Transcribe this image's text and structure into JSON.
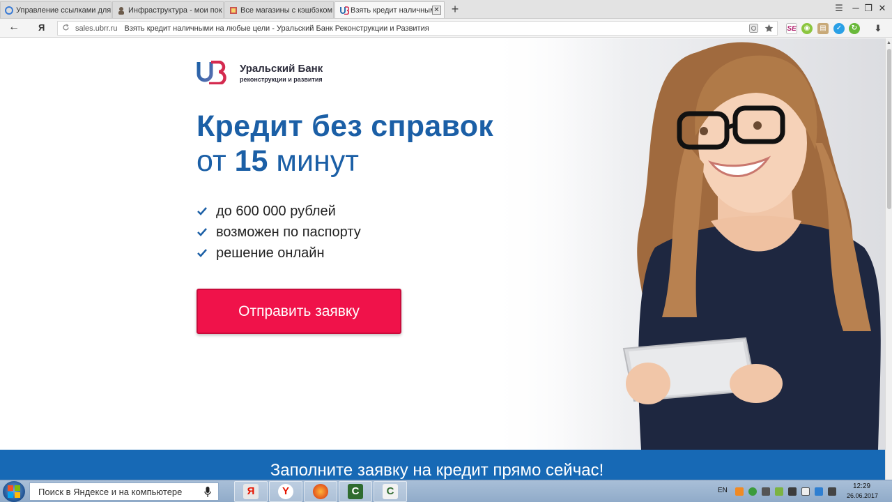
{
  "browser": {
    "tabs": [
      {
        "label": "Управление ссылками для",
        "active": false
      },
      {
        "label": "Инфраструктура - мои пок",
        "active": false
      },
      {
        "label": "Все магазины с кэшбэком -",
        "active": false
      },
      {
        "label": "Взять кредит наличными",
        "active": true
      }
    ],
    "new_tab": "+",
    "close_tab": "✕",
    "back_glyph": "←",
    "yandex_glyph": "Я",
    "url_domain": "sales.ubrr.ru",
    "page_title": "Взять кредит наличными на любые цели - Уральский Банк Реконструкции и Развития",
    "win_menu": "☰",
    "win_min": "─",
    "win_restore": "❐",
    "win_close": "✕",
    "download_glyph": "⬇"
  },
  "page": {
    "bank_name": "Уральский Банк",
    "bank_sub": "реконструкции и развития",
    "headline_1": "Кредит без справок",
    "headline_2_pre": "от ",
    "headline_2_num": "15",
    "headline_2_post": " минут",
    "features": [
      "до 600 000 рублей",
      "возможен по паспорту",
      "решение онлайн"
    ],
    "cta_label": "Отправить заявку",
    "band_text": "Заполните заявку на кредит прямо сейчас!"
  },
  "taskbar": {
    "search_placeholder": "Поиск в Яндексе и на компьютере",
    "lang": "EN",
    "time": "12:29",
    "date": "26.06.2017"
  },
  "colors": {
    "brand_blue": "#1b5fa6",
    "cta_red": "#f0124a",
    "band_blue": "#1769b5"
  }
}
